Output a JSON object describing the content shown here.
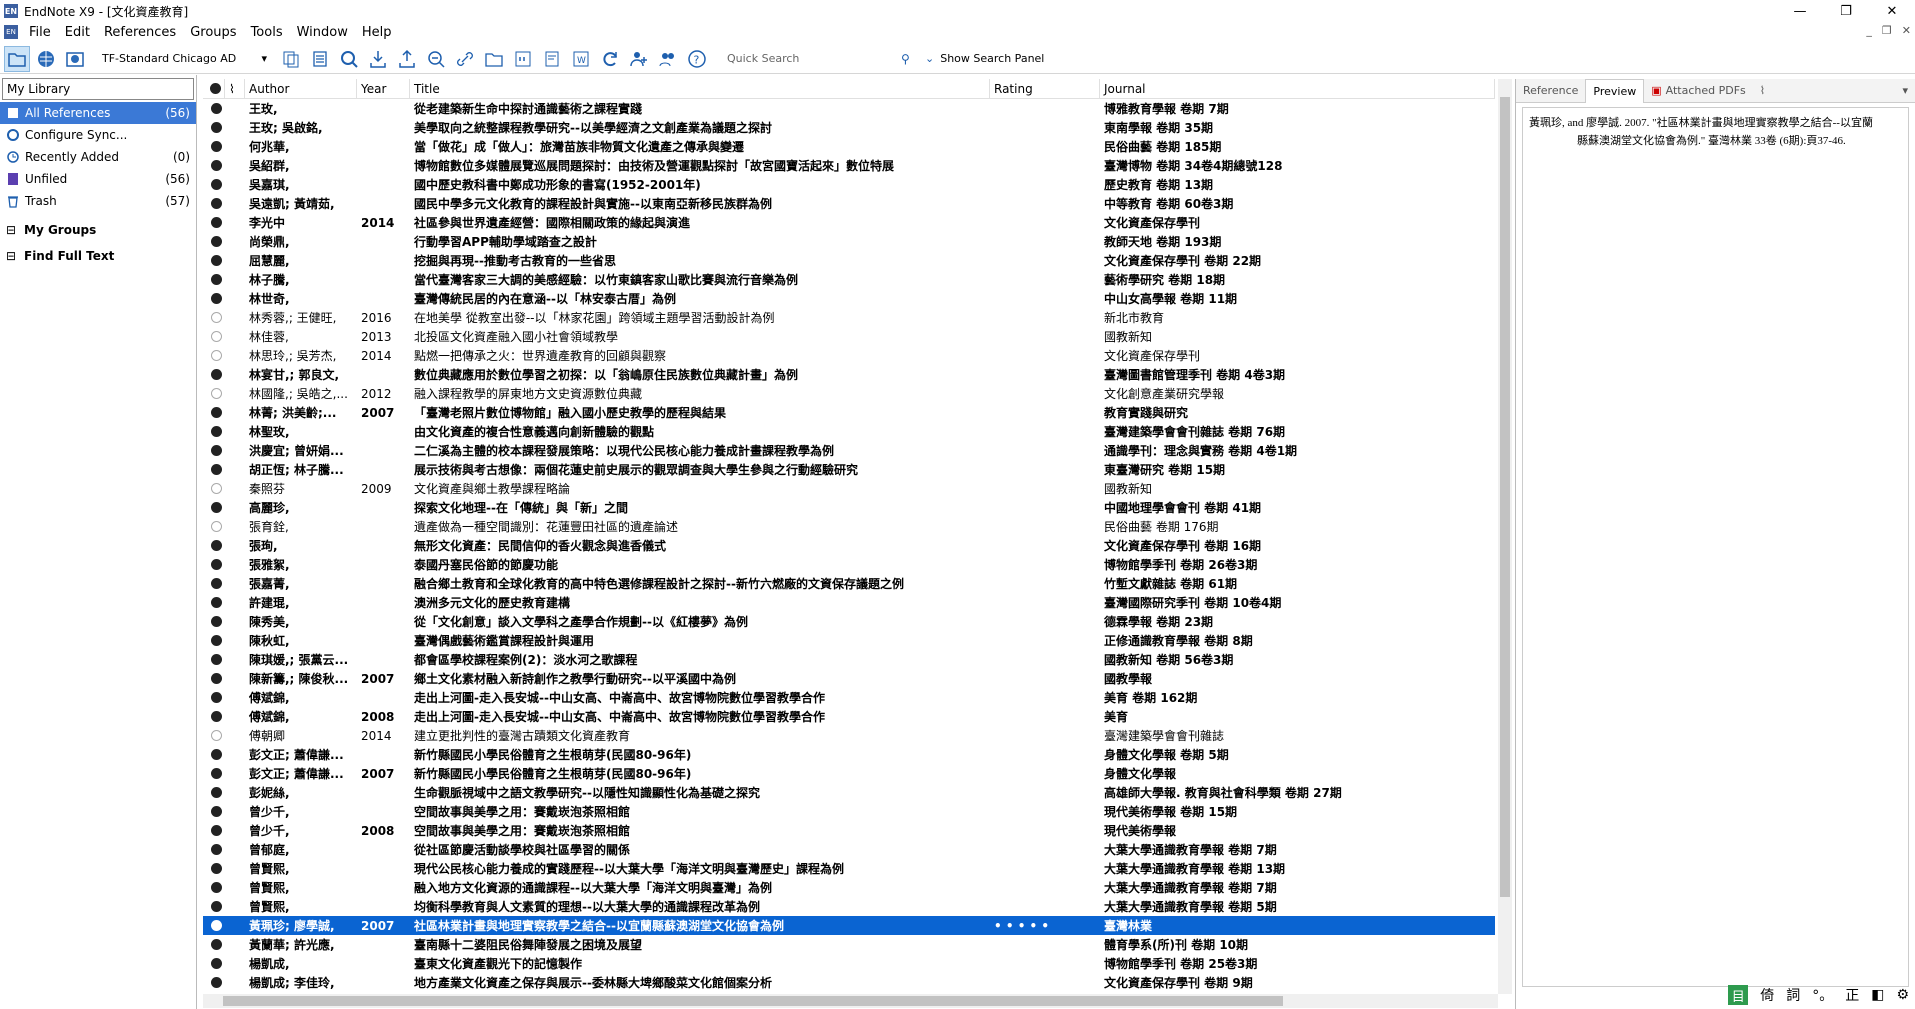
{
  "window": {
    "title": "EndNote X9 - [文化資產教育]"
  },
  "menu": [
    "File",
    "Edit",
    "References",
    "Groups",
    "Tools",
    "Window",
    "Help"
  ],
  "toolbar": {
    "style": "TF-Standard Chicago AD",
    "search_placeholder": "Quick Search",
    "show_search_panel": "Show Search Panel"
  },
  "sidebar": {
    "mylib": "My Library",
    "items": [
      {
        "label": "All References",
        "count": "(56)"
      },
      {
        "label": "Configure Sync...",
        "count": ""
      },
      {
        "label": "Recently Added",
        "count": "(0)"
      },
      {
        "label": "Unfiled",
        "count": "(56)"
      },
      {
        "label": "Trash",
        "count": "(57)"
      }
    ],
    "groups": [
      "My Groups",
      "Find Full Text"
    ]
  },
  "columns": {
    "author": "Author",
    "year": "Year",
    "title": "Title",
    "rating": "Rating",
    "journal": "Journal"
  },
  "rows": [
    {
      "a": "王玫,",
      "y": "",
      "t": "從老建築新生命中探討通識藝術之課程實踐",
      "j": "博雅教育學報 卷期 7期",
      "b": true
    },
    {
      "a": "王玫; 吳啟銘,",
      "y": "",
      "t": "美學取向之統整課程教學研究--以美學經濟之文創產業為議題之探討",
      "j": "東南學報 卷期 35期",
      "b": true
    },
    {
      "a": "何兆華,",
      "y": "",
      "t": "當「做花」成「做人」：旅灣苗族非物質文化遺產之傳承與變遷",
      "j": "民俗曲藝 卷期 185期",
      "b": true
    },
    {
      "a": "吳紹群,",
      "y": "",
      "t": "博物館數位多媒體展覽巡展問題探討：由技術及營運觀點探討「故宮國寶活起來」數位特展",
      "j": "臺灣博物 卷期 34卷4期總號128",
      "b": true
    },
    {
      "a": "吳嘉琪,",
      "y": "",
      "t": "國中歷史教科書中鄭成功形象的書寫(1952-2001年)",
      "j": "歷史教育 卷期 13期",
      "b": true
    },
    {
      "a": "吳遠凱; 黃靖茹,",
      "y": "",
      "t": "國民中學多元文化教育的課程設計與實施--以東南亞新移民族群為例",
      "j": "中等教育 卷期 60卷3期",
      "b": true
    },
    {
      "a": "李光中",
      "y": "2014",
      "t": "社區參與世界遺產經營：國際相關政策的緣起與演進",
      "j": "文化資產保存學刊",
      "b": true
    },
    {
      "a": "尚榮鼎,",
      "y": "",
      "t": "行動學習APP輔助學域踏查之設計",
      "j": "教師天地 卷期 193期",
      "b": true
    },
    {
      "a": "屈慧麗,",
      "y": "",
      "t": "挖掘與再現--推動考古教育的一些省思",
      "j": "文化資產保存學刊 卷期 22期",
      "b": true
    },
    {
      "a": "林子騰,",
      "y": "",
      "t": "當代臺灣客家三大調的美感經驗：以竹東鎮客家山歌比賽與流行音樂為例",
      "j": "藝術學研究 卷期 18期",
      "b": true
    },
    {
      "a": "林世奇,",
      "y": "",
      "t": "臺灣傳統民居的內在意涵--以「林安泰古厝」為例",
      "j": "中山女高學報 卷期 11期",
      "b": true
    },
    {
      "a": "林秀蓉,; 王健旺,",
      "y": "2016",
      "t": "在地美學 從教室出發--以「林家花園」跨領域主題學習活動設計為例",
      "j": "新北市教育",
      "b": false
    },
    {
      "a": "林佳蓉,",
      "y": "2013",
      "t": "北投區文化資產融入國小社會領域教學",
      "j": "國教新知",
      "b": false
    },
    {
      "a": "林思玲,; 吳芳杰,",
      "y": "2014",
      "t": "點燃一把傳承之火：世界遺產教育的回顧與觀察",
      "j": "文化資產保存學刊",
      "b": false
    },
    {
      "a": "林宴甘,; 郭良文,",
      "y": "",
      "t": "數位典藏應用於數位學習之初探：以「翁嶋原住民族數位典藏計畫」為例",
      "j": "臺灣圖書館管理季刊 卷期 4卷3期",
      "b": true
    },
    {
      "a": "林國隆,; 吳皓之,...",
      "y": "2012",
      "t": "融入課程教學的屏東地方文史資源數位典藏",
      "j": "文化創意產業研究學報",
      "b": false
    },
    {
      "a": "林菁; 洪美齡;...",
      "y": "2007",
      "t": "「臺灣老照片數位博物館」融入國小歷史教學的歷程與結果",
      "j": "教育實踐與研究",
      "b": true
    },
    {
      "a": "林聖玫,",
      "y": "",
      "t": "由文化資產的複合性意義邁向創新體驗的觀點",
      "j": "臺灣建築學會會刊雜誌 卷期 76期",
      "b": true
    },
    {
      "a": "洪慶宜; 曾妍娟...",
      "y": "",
      "t": "二仁溪為主體的校本課程發展策略：以現代公民核心能力養成計畫課程教學為例",
      "j": "通識學刊：理念與實務 卷期 4卷1期",
      "b": true
    },
    {
      "a": "胡正恆; 林子騰...",
      "y": "",
      "t": "展示技術與考古想像：兩個花蓮史前史展示的觀眾調查與大學生參與之行動經驗研究",
      "j": "東臺灣研究 卷期 15期",
      "b": true
    },
    {
      "a": "秦照芬",
      "y": "2009",
      "t": "文化資產與鄉土教學課程略論",
      "j": "國教新知",
      "b": false
    },
    {
      "a": "高麗珍,",
      "y": "",
      "t": "探索文化地理--在「傳統」與「新」之間",
      "j": "中國地理學會會刊 卷期 41期",
      "b": true
    },
    {
      "a": "張育銓,",
      "y": "",
      "t": "遺產做為一種空間識別：花蓮豐田社區的遺產論述",
      "j": "民俗曲藝 卷期 176期",
      "b": false
    },
    {
      "a": "張珣,",
      "y": "",
      "t": "無形文化資產：民間信仰的香火觀念與進香儀式",
      "j": "文化資產保存學刊 卷期 16期",
      "b": true
    },
    {
      "a": "張雅絮,",
      "y": "",
      "t": "泰國丹塞民俗節的節慶功能",
      "j": "博物館學季刊 卷期 26卷3期",
      "b": true
    },
    {
      "a": "張嘉菁,",
      "y": "",
      "t": "融合鄉土教育和全球化教育的高中特色選修課程設計之探討--新竹六燃廠的文資保存議題之例",
      "j": "竹塹文獻雜誌 卷期 61期",
      "b": true
    },
    {
      "a": "許建琨,",
      "y": "",
      "t": "澳洲多元文化的歷史教育建構",
      "j": "臺灣國際研究季刊 卷期 10卷4期",
      "b": true
    },
    {
      "a": "陳秀美,",
      "y": "",
      "t": "從「文化創意」談入文學科之產學合作規劃--以《紅樓夢》為例",
      "j": "德霖學報 卷期 23期",
      "b": true
    },
    {
      "a": "陳秋虹,",
      "y": "",
      "t": "臺灣偶戲藝術鑑賞課程設計與運用",
      "j": "正修通識教育學報 卷期 8期",
      "b": true
    },
    {
      "a": "陳琪媛,; 張黨云...",
      "y": "",
      "t": "都會區學校課程案例(2)：淡水河之歌課程",
      "j": "國教新知 卷期 56卷3期",
      "b": true
    },
    {
      "a": "陳新籌,; 陳俊秋...",
      "y": "2007",
      "t": "鄉土文化素材融入新詩創作之教學行動研究--以平溪國中為例",
      "j": "國教學報",
      "b": true
    },
    {
      "a": "傅斌錦,",
      "y": "",
      "t": "走出上河圖-走入長安城--中山女高、中崙高中、故宮博物院數位學習教學合作",
      "j": "美育 卷期 162期",
      "b": true
    },
    {
      "a": "傅斌錦,",
      "y": "2008",
      "t": "走出上河圖-走入長安城--中山女高、中崙高中、故宮博物院數位學習教學合作",
      "j": "美育",
      "b": true
    },
    {
      "a": "傅朝卿",
      "y": "2014",
      "t": "建立更批判性的臺灣古蹟類文化資產教育",
      "j": "臺灣建築學會會刊雜誌",
      "b": false
    },
    {
      "a": "彭文正; 蕭偉謙...",
      "y": "",
      "t": "新竹縣國民小學民俗體育之生根萌芽(民國80-96年)",
      "j": "身體文化學報 卷期 5期",
      "b": true
    },
    {
      "a": "彭文正; 蕭偉謙...",
      "y": "2007",
      "t": "新竹縣國民小學民俗體育之生根萌芽(民國80-96年)",
      "j": "身體文化學報",
      "b": true
    },
    {
      "a": "彭妮絲,",
      "y": "",
      "t": "生命觀脈視域中之語文教學研究--以隱性知識顯性化為基礎之探究",
      "j": "高雄師大學報. 教育與社會科學類 卷期 27期",
      "b": true
    },
    {
      "a": "曾少千,",
      "y": "",
      "t": "空間故事與美學之用：賽戴崁泡茶照相館",
      "j": "現代美術學報 卷期 15期",
      "b": true
    },
    {
      "a": "曾少千,",
      "y": "2008",
      "t": "空間故事與美學之用：賽戴崁泡茶照相館",
      "j": "現代美術學報",
      "b": true
    },
    {
      "a": "曾郁庭,",
      "y": "",
      "t": "從社區節慶活動談學校與社區學習的關係",
      "j": "大葉大學通識教育學報 卷期 7期",
      "b": true
    },
    {
      "a": "曾賢熙,",
      "y": "",
      "t": "現代公民核心能力養成的實踐歷程--以大葉大學「海洋文明與臺灣歷史」課程為例",
      "j": "大葉大學通識教育學報 卷期 13期",
      "b": true
    },
    {
      "a": "曾賢熙,",
      "y": "",
      "t": "融入地方文化資源的通識課程--以大葉大學「海洋文明與臺灣」為例",
      "j": "大葉大學通識教育學報 卷期 7期",
      "b": true
    },
    {
      "a": "曾賢熙,",
      "y": "",
      "t": "均衡科學教育與人文素質的理想--以大葉大學的通識課程改革為例",
      "j": "大葉大學通識教育學報 卷期 5期",
      "b": true
    },
    {
      "a": "黃珮珍; 廖學誠,",
      "y": "2007",
      "t": "社區林業計畫與地理實察教學之結合--以宜蘭縣蘇澳湖堂文化協會為例",
      "j": "臺灣林業",
      "b": true,
      "sel": true
    },
    {
      "a": "黃蘭華; 許光應,",
      "y": "",
      "t": "臺南縣十二婆阻民俗舞陣發展之困境及展望",
      "j": "體育學系(所)刊 卷期 10期",
      "b": true
    },
    {
      "a": "楊凱成,",
      "y": "",
      "t": "臺東文化資產觀光下的記憶製作",
      "j": "博物館學季刊 卷期 25卷3期",
      "b": true
    },
    {
      "a": "楊凱成; 李佳玲,",
      "y": "",
      "t": "地方產業文化資產之保存與展示--委林縣大埤鄉酸菜文化館個案分析",
      "j": "文化資產保存學刊 卷期 9期",
      "b": true
    }
  ],
  "preview": {
    "tabs": [
      "Reference",
      "Preview",
      "Attached PDFs"
    ],
    "line1": "黃珮珍, and 廖學誠. 2007. \"社區林業計畫與地理實察教學之結合--以宜蘭",
    "line2": "縣蘇澳湖堂文化協會為例.\" 臺灣林業 33卷 (6期):頁37-46."
  },
  "tray": [
    "倚",
    "詞",
    "°。",
    "正"
  ]
}
